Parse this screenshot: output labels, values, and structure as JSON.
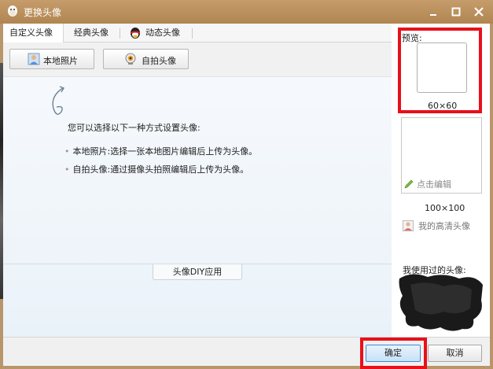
{
  "window": {
    "title": "更换头像"
  },
  "tabs": [
    "自定义头像",
    "经典头像",
    "动态头像"
  ],
  "toolbar": {
    "local_photo": "本地照片",
    "selfie": "自拍头像"
  },
  "content": {
    "intro": "您可以选择以下一种方式设置头像:",
    "bullets": [
      "本地照片:选择一张本地图片编辑后上传为头像。",
      "自拍头像:通过摄像头拍照编辑后上传为头像。"
    ],
    "diy_tab": "头像DIY应用"
  },
  "preview": {
    "label": "预览:",
    "size_small": "60×60",
    "edit": "点击编辑",
    "size_large": "100×100",
    "hd": "我的高清头像",
    "used_label": "我使用过的头像:"
  },
  "buttons": {
    "ok": "确定",
    "cancel": "取消"
  },
  "colors": {
    "titlebar": "#b08552",
    "highlight": "#e8101a",
    "primary_button": "#3d8ad4"
  }
}
